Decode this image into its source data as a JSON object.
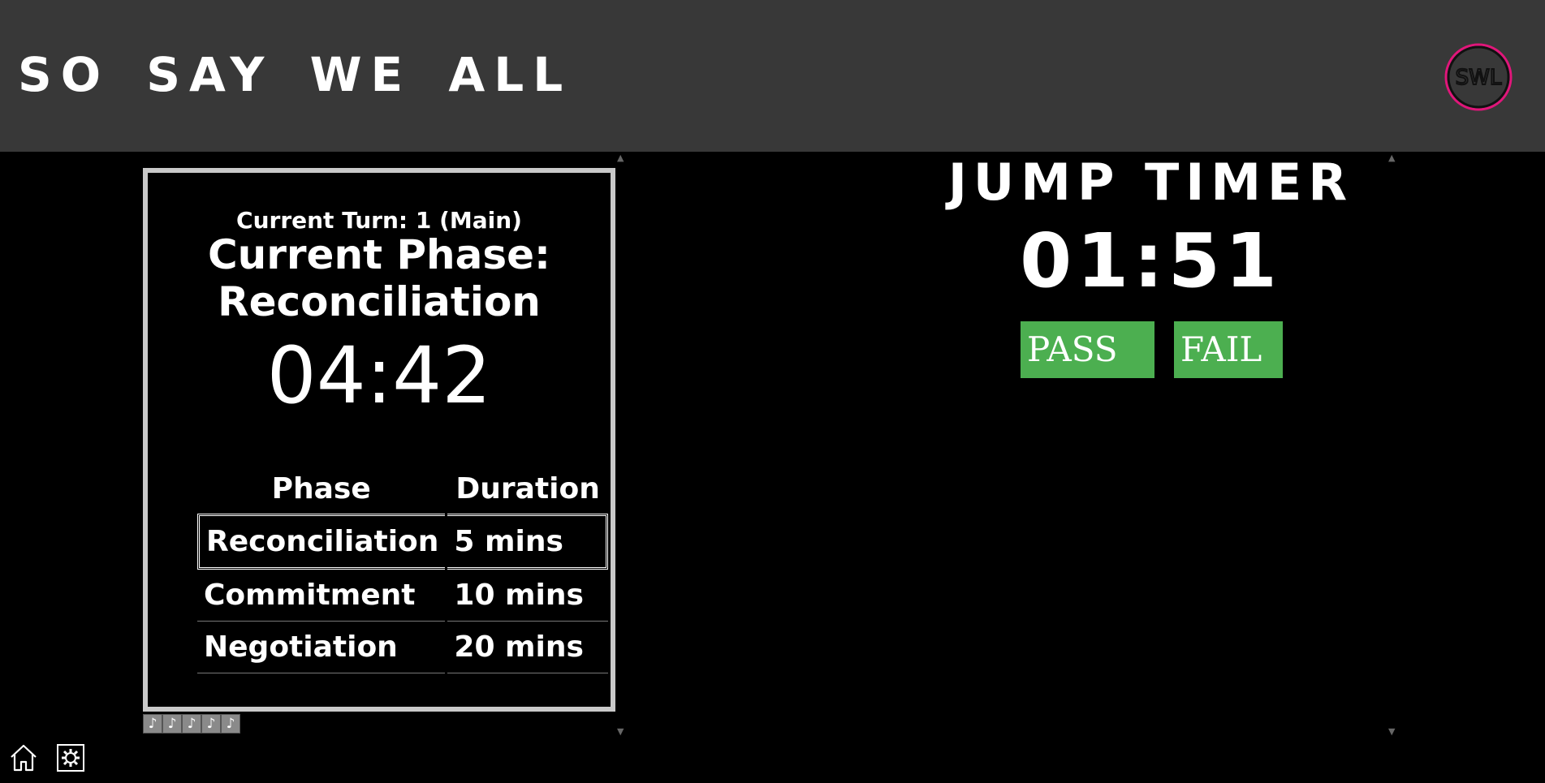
{
  "header": {
    "title": "SO SAY WE ALL",
    "logo_text": "SWL",
    "accent_color": "#e0167a"
  },
  "phase_panel": {
    "turn": "Current Turn: 1 (Main)",
    "phase": "Current Phase: Reconciliation",
    "timer": "04:42",
    "table": {
      "headers": [
        "Phase",
        "Duration"
      ],
      "rows": [
        {
          "phase": "Reconciliation",
          "duration": "5 mins",
          "active": true
        },
        {
          "phase": "Commitment",
          "duration": "10 mins",
          "active": false
        },
        {
          "phase": "Negotiation",
          "duration": "20 mins",
          "active": false
        }
      ]
    }
  },
  "music_buttons": [
    "music-note",
    "music-note",
    "music-note",
    "music-note",
    "music-note"
  ],
  "jump": {
    "title": "JUMP TIMER",
    "timer": "01:51",
    "pass_label": "PASS",
    "fail_label": "FAIL",
    "button_color": "#4caf50"
  },
  "nav": [
    "home-icon",
    "gear-icon"
  ]
}
